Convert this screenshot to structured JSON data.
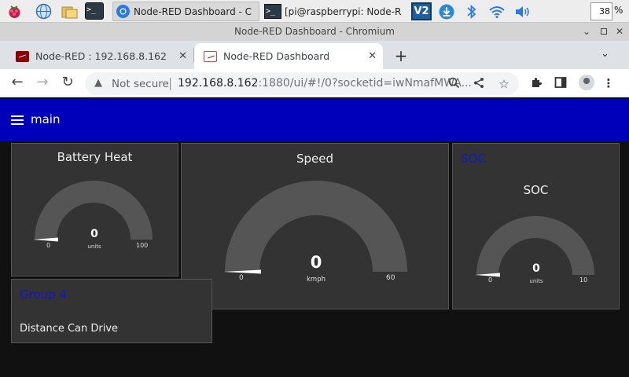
{
  "taskbar": {
    "tasks": [
      {
        "label": "Node-RED Dashboard - C",
        "icon": "chromium-icon"
      },
      {
        "label": "[pi@raspberrypi: Node-R",
        "icon": "terminal-icon"
      }
    ],
    "cpu_value": "38",
    "cpu_unit": "%"
  },
  "window": {
    "title": "Node-RED Dashboard - Chromium"
  },
  "tabs": [
    {
      "label": "Node-RED : 192.168.8.162"
    },
    {
      "label": "Node-RED Dashboard"
    }
  ],
  "omnibox": {
    "security_label": "Not secure",
    "url_host": "192.168.8.162",
    "url_rest": ":1880/ui/#!/0?socketid=iwNmafMWA..."
  },
  "dashboard": {
    "title": "main",
    "accent": "#0000bb",
    "widgets": {
      "battery": {
        "title": "Battery Heat",
        "value": "0",
        "units": "units",
        "min": "0",
        "max": "100",
        "level": 0
      },
      "speed": {
        "title": "Speed",
        "value": "0",
        "units": "kmph",
        "min": "0",
        "max": "60",
        "level": 0
      },
      "soc": {
        "group": "SOC",
        "title": "SOC",
        "value": "0",
        "units": "units",
        "min": "0",
        "max": "10",
        "level": 0
      },
      "group4": {
        "group": "Group 4",
        "text": "Distance Can Drive"
      }
    }
  }
}
